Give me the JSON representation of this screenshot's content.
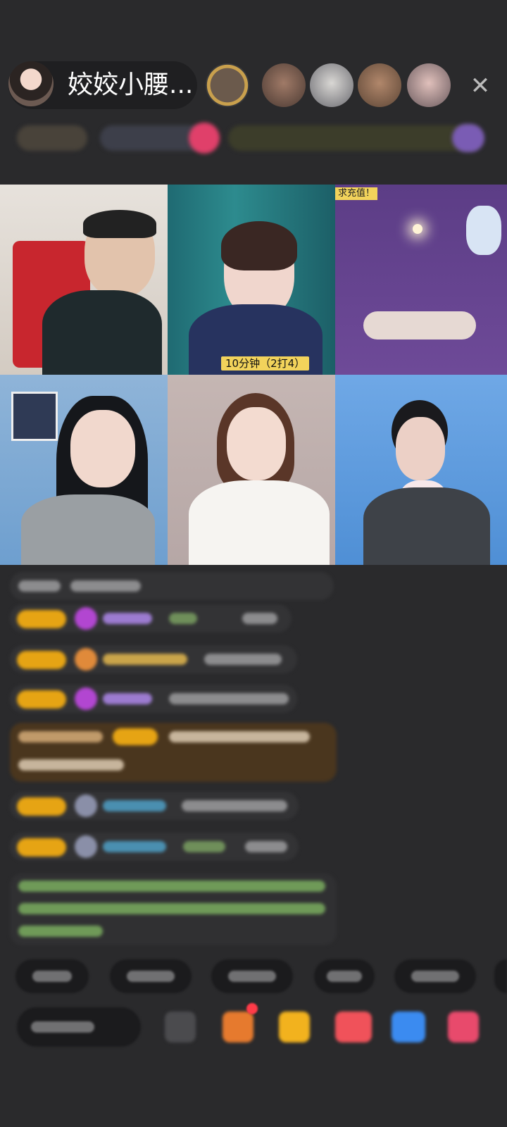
{
  "header": {
    "host_name": "姣姣小腰...",
    "close_glyph": "✕"
  },
  "video_grid": {
    "tile2_caption": "10分钟（2打4）",
    "tile3_caption": "求充值！"
  },
  "colors": {
    "background": "#2a2a2c",
    "fan_badge": "#e6a414",
    "caption_bg": "#f2d35b"
  },
  "icons": {
    "close": "close-icon",
    "emoji": "emoji-icon",
    "gift": "gift-icon",
    "gift_box": "gift-box-icon",
    "shop": "shop-icon",
    "more": "more-icon"
  }
}
